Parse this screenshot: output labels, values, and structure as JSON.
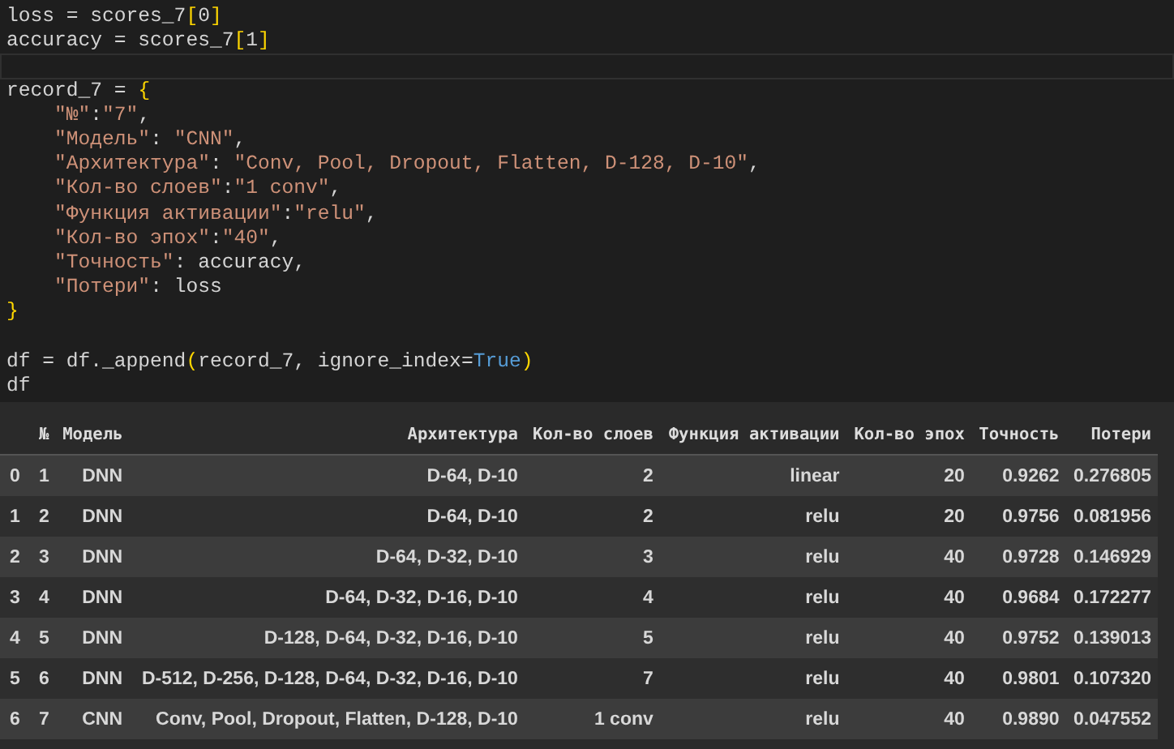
{
  "code_lines": [
    {
      "current": false,
      "indented": false,
      "tokens": [
        {
          "kind": "plain",
          "text": "loss = scores_7"
        },
        {
          "kind": "bracket",
          "text": "["
        },
        {
          "kind": "plain",
          "text": "0"
        },
        {
          "kind": "bracket",
          "text": "]"
        }
      ]
    },
    {
      "current": false,
      "indented": false,
      "tokens": [
        {
          "kind": "plain",
          "text": "accuracy = scores_7"
        },
        {
          "kind": "bracket",
          "text": "["
        },
        {
          "kind": "plain",
          "text": "1"
        },
        {
          "kind": "bracket",
          "text": "]"
        }
      ]
    },
    {
      "current": true
    },
    {
      "current": false,
      "indented": false,
      "tokens": [
        {
          "kind": "plain",
          "text": "record_7 = "
        },
        {
          "kind": "bracket",
          "text": "{"
        }
      ]
    },
    {
      "current": false,
      "indented": true,
      "tokens": [
        {
          "kind": "string",
          "text": "\"№\""
        },
        {
          "kind": "plain",
          "text": ":"
        },
        {
          "kind": "string",
          "text": "\"7\""
        },
        {
          "kind": "plain",
          "text": ","
        }
      ]
    },
    {
      "current": false,
      "indented": true,
      "tokens": [
        {
          "kind": "string",
          "text": "\"Модель\""
        },
        {
          "kind": "plain",
          "text": ": "
        },
        {
          "kind": "string",
          "text": "\"CNN\""
        },
        {
          "kind": "plain",
          "text": ","
        }
      ]
    },
    {
      "current": false,
      "indented": true,
      "tokens": [
        {
          "kind": "string",
          "text": "\"Архитектура\""
        },
        {
          "kind": "plain",
          "text": ": "
        },
        {
          "kind": "string",
          "text": "\"Conv, Pool, Dropout, Flatten, D-128, D-10\""
        },
        {
          "kind": "plain",
          "text": ","
        }
      ]
    },
    {
      "current": false,
      "indented": true,
      "tokens": [
        {
          "kind": "string",
          "text": "\"Кол-во слоев\""
        },
        {
          "kind": "plain",
          "text": ":"
        },
        {
          "kind": "string",
          "text": "\"1 conv\""
        },
        {
          "kind": "plain",
          "text": ","
        }
      ]
    },
    {
      "current": false,
      "indented": true,
      "tokens": [
        {
          "kind": "string",
          "text": "\"Функция активации\""
        },
        {
          "kind": "plain",
          "text": ":"
        },
        {
          "kind": "string",
          "text": "\"relu\""
        },
        {
          "kind": "plain",
          "text": ","
        }
      ]
    },
    {
      "current": false,
      "indented": true,
      "tokens": [
        {
          "kind": "string",
          "text": "\"Кол-во эпох\""
        },
        {
          "kind": "plain",
          "text": ":"
        },
        {
          "kind": "string",
          "text": "\"40\""
        },
        {
          "kind": "plain",
          "text": ","
        }
      ]
    },
    {
      "current": false,
      "indented": true,
      "tokens": [
        {
          "kind": "string",
          "text": "\"Точность\""
        },
        {
          "kind": "plain",
          "text": ": accuracy,"
        }
      ]
    },
    {
      "current": false,
      "indented": true,
      "tokens": [
        {
          "kind": "string",
          "text": "\"Потери\""
        },
        {
          "kind": "plain",
          "text": ": loss"
        }
      ]
    },
    {
      "current": false,
      "indented": false,
      "tokens": [
        {
          "kind": "bracket",
          "text": "}"
        }
      ]
    },
    {
      "current": false
    },
    {
      "current": false,
      "indented": false,
      "tokens": [
        {
          "kind": "plain",
          "text": "df = df._append"
        },
        {
          "kind": "bracket",
          "text": "("
        },
        {
          "kind": "plain",
          "text": "record_7, ignore_index="
        },
        {
          "kind": "keyword",
          "text": "True"
        },
        {
          "kind": "bracket",
          "text": ")"
        }
      ]
    },
    {
      "current": false,
      "indented": false,
      "tokens": [
        {
          "kind": "plain",
          "text": "df"
        }
      ]
    }
  ],
  "table": {
    "columns": [
      "№",
      "Модель",
      "Архитектура",
      "Кол-во слоев",
      "Функция активации",
      "Кол-во эпох",
      "Точность",
      "Потери"
    ],
    "rows": [
      {
        "index": "0",
        "cells": [
          "1",
          "DNN",
          "D-64, D-10",
          "2",
          "linear",
          "20",
          "0.9262",
          "0.276805"
        ]
      },
      {
        "index": "1",
        "cells": [
          "2",
          "DNN",
          "D-64, D-10",
          "2",
          "relu",
          "20",
          "0.9756",
          "0.081956"
        ]
      },
      {
        "index": "2",
        "cells": [
          "3",
          "DNN",
          "D-64, D-32, D-10",
          "3",
          "relu",
          "40",
          "0.9728",
          "0.146929"
        ]
      },
      {
        "index": "3",
        "cells": [
          "4",
          "DNN",
          "D-64, D-32, D-16, D-10",
          "4",
          "relu",
          "40",
          "0.9684",
          "0.172277"
        ]
      },
      {
        "index": "4",
        "cells": [
          "5",
          "DNN",
          "D-128, D-64, D-32, D-16, D-10",
          "5",
          "relu",
          "40",
          "0.9752",
          "0.139013"
        ]
      },
      {
        "index": "5",
        "cells": [
          "6",
          "DNN",
          "D-512, D-256, D-128, D-64, D-32, D-16, D-10",
          "7",
          "relu",
          "40",
          "0.9801",
          "0.107320"
        ]
      },
      {
        "index": "6",
        "cells": [
          "7",
          "CNN",
          "Conv, Pool, Dropout, Flatten, D-128, D-10",
          "1 conv",
          "relu",
          "40",
          "0.9890",
          "0.047552"
        ]
      }
    ]
  }
}
